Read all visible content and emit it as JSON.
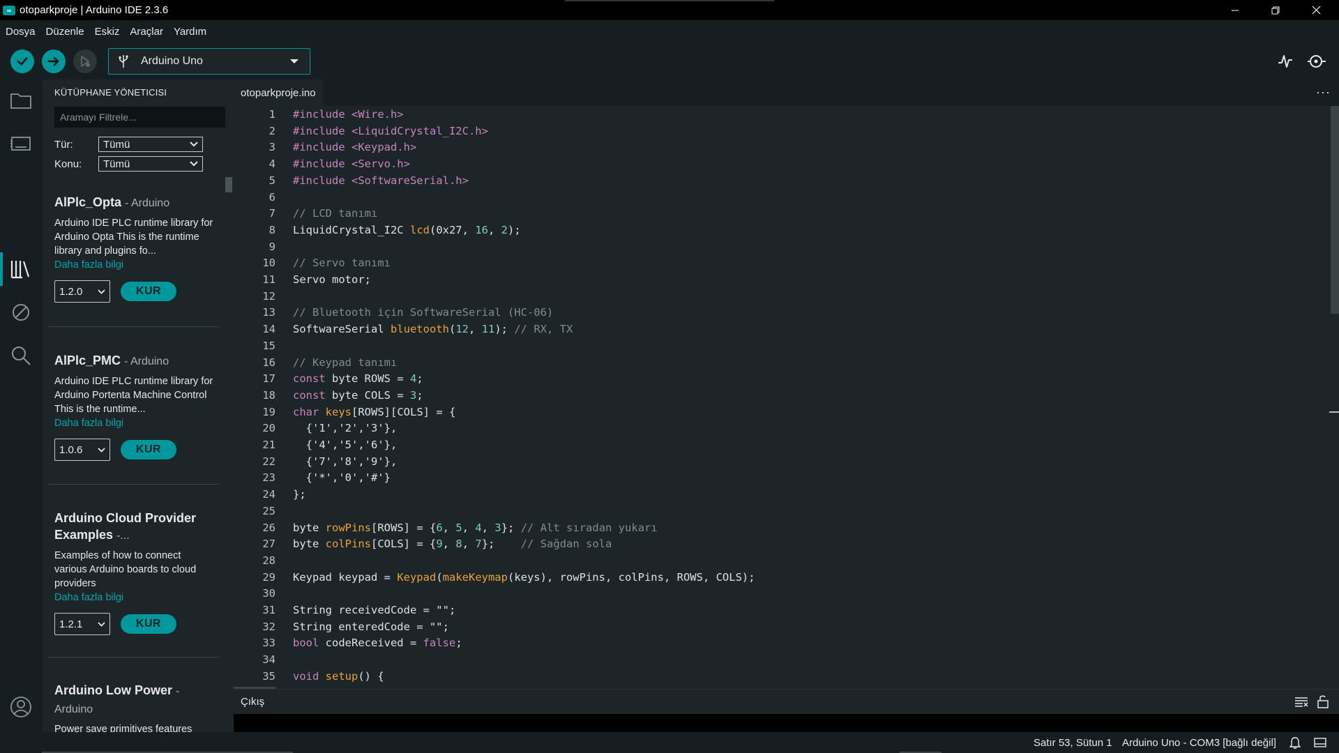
{
  "window": {
    "title": "otoparkproje | Arduino IDE 2.3.6",
    "icon": "arduino-logo-icon",
    "controls": [
      "minimize-icon",
      "restore-icon",
      "close-icon"
    ]
  },
  "menu": [
    "Dosya",
    "Düzenle",
    "Eskiz",
    "Araçlar",
    "Yardım"
  ],
  "toolbar": {
    "board_label": "Arduino Uno",
    "buttons": [
      "verify-icon",
      "upload-icon",
      "debug-icon"
    ],
    "right_buttons": [
      "serial-plotter-icon",
      "serial-monitor-icon"
    ]
  },
  "activity_bar": [
    "folder-icon",
    "boards-manager-icon",
    "library-manager-icon",
    "debug-icon",
    "search-icon",
    "account-icon"
  ],
  "library_manager": {
    "title": "KÜTÜPHANE YÖNETICISI",
    "search_placeholder": "Aramayı Filtrele...",
    "filters": [
      {
        "label": "Tür:",
        "value": "Tümü"
      },
      {
        "label": "Konu:",
        "value": "Tümü"
      }
    ],
    "libraries": [
      {
        "name": "AlPlc_Opta",
        "author": "- Arduino",
        "desc": "Arduino IDE PLC runtime library for Arduino Opta This is the runtime library and plugins fo...",
        "more": "Daha fazla bilgi",
        "version": "1.2.0",
        "install": "KUR"
      },
      {
        "name": "AlPlc_PMC",
        "author": "- Arduino",
        "desc": "Arduino IDE PLC runtime library for Arduino Portenta Machine Control This is the runtime...",
        "more": "Daha fazla bilgi",
        "version": "1.0.6",
        "install": "KUR"
      },
      {
        "name": "Arduino Cloud Provider Examples",
        "author": "-...",
        "desc": "Examples of how to connect various Arduino boards to cloud providers",
        "more": "Daha fazla bilgi",
        "version": "1.2.1",
        "install": "KUR"
      },
      {
        "name": "Arduino Low Power",
        "author": "- Arduino",
        "desc": "Power save primitives features",
        "more": "",
        "version": "",
        "install": ""
      }
    ]
  },
  "editor": {
    "tab": "otoparkproje.ino",
    "line_numbers": [
      "1",
      "2",
      "3",
      "4",
      "5",
      "6",
      "7",
      "8",
      "9",
      "10",
      "11",
      "12",
      "13",
      "14",
      "15",
      "16",
      "17",
      "18",
      "19",
      "20",
      "21",
      "22",
      "23",
      "24",
      "25",
      "26",
      "27",
      "28",
      "29",
      "30",
      "31",
      "32",
      "33",
      "34",
      "35"
    ],
    "lines": [
      [
        [
          "#include <Wire.h>",
          "pp"
        ]
      ],
      [
        [
          "#include <LiquidCrystal_I2C.h>",
          "pp"
        ]
      ],
      [
        [
          "#include <Keypad.h>",
          "pp"
        ]
      ],
      [
        [
          "#include <Servo.h>",
          "pp"
        ]
      ],
      [
        [
          "#include <SoftwareSerial.h>",
          "pp"
        ]
      ],
      [],
      [
        [
          "// LCD tanımı",
          "cm"
        ]
      ],
      [
        [
          "LiquidCrystal_I2C ",
          "tx"
        ],
        [
          "lcd",
          "fn"
        ],
        [
          "(0x27, ",
          "tx"
        ],
        [
          "16",
          "nm"
        ],
        [
          ", ",
          "tx"
        ],
        [
          "2",
          "nm"
        ],
        [
          ");",
          "tx"
        ]
      ],
      [],
      [
        [
          "// Servo tanımı",
          "cm"
        ]
      ],
      [
        [
          "Servo motor;",
          "tx"
        ]
      ],
      [],
      [
        [
          "// Bluetooth için SoftwareSerial (HC-06)",
          "cm"
        ]
      ],
      [
        [
          "SoftwareSerial ",
          "tx"
        ],
        [
          "bluetooth",
          "fn"
        ],
        [
          "(",
          "tx"
        ],
        [
          "12",
          "nm"
        ],
        [
          ", ",
          "tx"
        ],
        [
          "11",
          "nm"
        ],
        [
          "); ",
          "tx"
        ],
        [
          "// RX, TX",
          "cm"
        ]
      ],
      [],
      [
        [
          "// Keypad tanımı",
          "cm"
        ]
      ],
      [
        [
          "const",
          "kw"
        ],
        [
          " byte ROWS = ",
          "tx"
        ],
        [
          "4",
          "nm"
        ],
        [
          ";",
          "tx"
        ]
      ],
      [
        [
          "const",
          "kw"
        ],
        [
          " byte COLS = ",
          "tx"
        ],
        [
          "3",
          "nm"
        ],
        [
          ";",
          "tx"
        ]
      ],
      [
        [
          "char",
          "kw"
        ],
        [
          " ",
          "tx"
        ],
        [
          "keys",
          "fn"
        ],
        [
          "[ROWS][COLS] = {",
          "tx"
        ]
      ],
      [
        [
          "  {'1','2','3'},",
          "tx"
        ]
      ],
      [
        [
          "  {'4','5','6'},",
          "tx"
        ]
      ],
      [
        [
          "  {'7','8','9'},",
          "tx"
        ]
      ],
      [
        [
          "  {'*','0','#'}",
          "tx"
        ]
      ],
      [
        [
          "};",
          "tx"
        ]
      ],
      [],
      [
        [
          "byte ",
          "tx"
        ],
        [
          "rowPins",
          "fn"
        ],
        [
          "[ROWS] = {",
          "tx"
        ],
        [
          "6",
          "nm"
        ],
        [
          ", ",
          "tx"
        ],
        [
          "5",
          "nm"
        ],
        [
          ", ",
          "tx"
        ],
        [
          "4",
          "nm"
        ],
        [
          ", ",
          "tx"
        ],
        [
          "3",
          "nm"
        ],
        [
          "}; ",
          "tx"
        ],
        [
          "// Alt sıradan yukarı",
          "cm"
        ]
      ],
      [
        [
          "byte ",
          "tx"
        ],
        [
          "colPins",
          "fn"
        ],
        [
          "[COLS] = {",
          "tx"
        ],
        [
          "9",
          "nm"
        ],
        [
          ", ",
          "tx"
        ],
        [
          "8",
          "nm"
        ],
        [
          ", ",
          "tx"
        ],
        [
          "7",
          "nm"
        ],
        [
          "};    ",
          "tx"
        ],
        [
          "// Sağdan sola",
          "cm"
        ]
      ],
      [],
      [
        [
          "Keypad keypad = ",
          "tx"
        ],
        [
          "Keypad",
          "fn"
        ],
        [
          "(",
          "tx"
        ],
        [
          "makeKeymap",
          "fn"
        ],
        [
          "(keys), rowPins, colPins, ROWS, COLS);",
          "tx"
        ]
      ],
      [],
      [
        [
          "String receivedCode = \"\";",
          "tx"
        ]
      ],
      [
        [
          "String enteredCode = \"\";",
          "tx"
        ]
      ],
      [
        [
          "bool",
          "kw"
        ],
        [
          " codeReceived = ",
          "tx"
        ],
        [
          "false",
          "kw"
        ],
        [
          ";",
          "tx"
        ]
      ],
      [],
      [
        [
          "void",
          "kw"
        ],
        [
          " ",
          "tx"
        ],
        [
          "setup",
          "fn"
        ],
        [
          "() {",
          "tx"
        ]
      ]
    ]
  },
  "output": {
    "title": "Çıkış",
    "icons": [
      "clear-output-icon",
      "lock-icon"
    ]
  },
  "status": {
    "cursor": "Satır 53, Sütun 1",
    "board": "Arduino Uno - COM3 [bağlı değil]",
    "icons": [
      "notification-bell-icon",
      "toggle-panel-icon"
    ]
  },
  "colors": {
    "accent": "#00979d",
    "preprocessor": "#c586c0",
    "comment": "#7f8c8d",
    "function": "#e8a23a",
    "number": "#7fcac3",
    "keyword": "#c586c0"
  }
}
